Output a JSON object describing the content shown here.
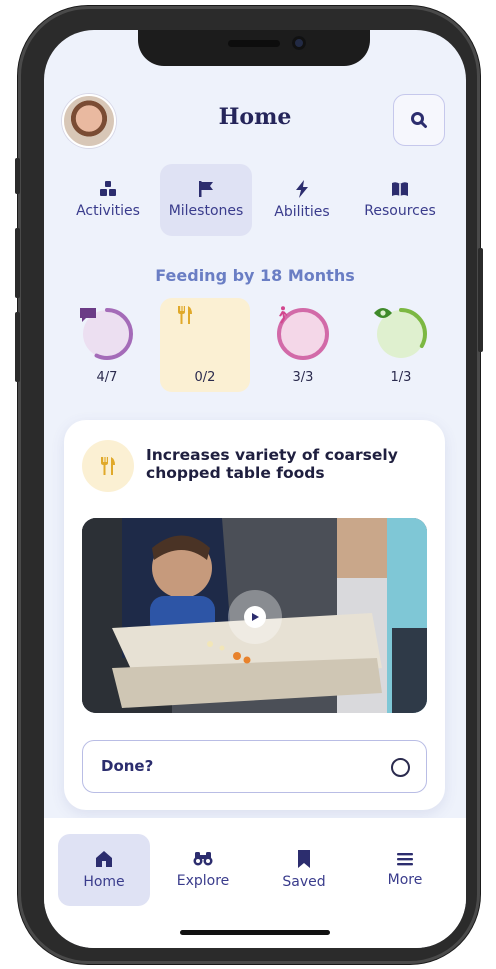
{
  "header": {
    "title": "Home"
  },
  "tabs": [
    {
      "label": "Activities",
      "icon": "activities-icon",
      "active": false
    },
    {
      "label": "Milestones",
      "icon": "flag-icon",
      "active": true
    },
    {
      "label": "Abilities",
      "icon": "lightning-icon",
      "active": false
    },
    {
      "label": "Resources",
      "icon": "book-icon",
      "active": false
    }
  ],
  "section": {
    "title": "Feeding by 18 Months"
  },
  "progress": [
    {
      "count": "4/7",
      "icon": "speech-bubble-icon",
      "color": "#a46bb8",
      "track": "#ecdff1",
      "fraction": 0.571
    },
    {
      "count": "0/2",
      "icon": "utensils-icon",
      "color": "#e0a92a",
      "track": "#fbf0d3",
      "fraction": 0.0
    },
    {
      "count": "3/3",
      "icon": "walking-person-icon",
      "color": "#d26aa8",
      "track": "#f4d7e8",
      "fraction": 1.0
    },
    {
      "count": "1/3",
      "icon": "eye-icon",
      "color": "#7cb842",
      "track": "#dff0cf",
      "fraction": 0.333
    }
  ],
  "milestone": {
    "title": "Increases variety of coarsely chopped table foods",
    "done_label": "Done?"
  },
  "bottom_nav": [
    {
      "label": "Home",
      "icon": "home-icon",
      "active": true
    },
    {
      "label": "Explore",
      "icon": "binoculars-icon",
      "active": false
    },
    {
      "label": "Saved",
      "icon": "bookmark-icon",
      "active": false
    },
    {
      "label": "More",
      "icon": "menu-icon",
      "active": false
    }
  ],
  "colors": {
    "accent": "#3a3c8c",
    "background": "#eef2fb",
    "section_title": "#6a7ec4"
  }
}
